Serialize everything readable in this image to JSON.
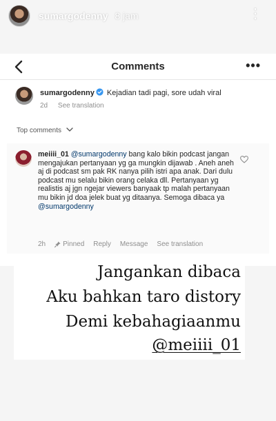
{
  "story": {
    "username": "sumargodenny",
    "time": "8 jam",
    "more_label": "⋮"
  },
  "comments_screen": {
    "title": "Comments",
    "more_label": "•••",
    "caption": {
      "username": "sumargodenny",
      "text": "Kejadian tadi pagi, sore udah viral",
      "age": "2d",
      "see_translation": "See translation"
    },
    "top_comments_label": "Top comments",
    "comment": {
      "username": "meiiii_01",
      "mention": "@sumargodenny",
      "text": "bang kalo bikin podcast jangan mengajukan pertanyaan yg ga mungkin dijawab . Aneh aneh aj di podcast sm pak RK nanya pilih istri apa anak. Dari dulu podcast mu selalu bikin orang celaka dll. Pertanyaan yg realistis aj jgn ngejar viewers banyaak tp malah pertanyaan mu bikin jd doa jelek buat yg ditaanya. Semoga dibaca ya",
      "mention_end": "@sumargodenny",
      "age": "2h",
      "pinned": "Pinned",
      "reply": "Reply",
      "message": "Message",
      "see_translation": "See translation"
    }
  },
  "overlay_text": {
    "line1": "Jangankan dibaca",
    "line2": "Aku bahkan taro distory",
    "line3": "Demi kebahagiaanmu",
    "line4": "@meiiii_01"
  },
  "colors": {
    "verified_blue": "#3897f0",
    "link_blue": "#00376b",
    "meta_gray": "#8e8e8e"
  },
  "icons": {
    "back": "chevron-left-icon",
    "more": "ellipsis-icon",
    "verified": "verified-badge-icon",
    "heart": "heart-outline-icon",
    "pin": "pin-icon",
    "chevron_down": "chevron-down-icon"
  }
}
